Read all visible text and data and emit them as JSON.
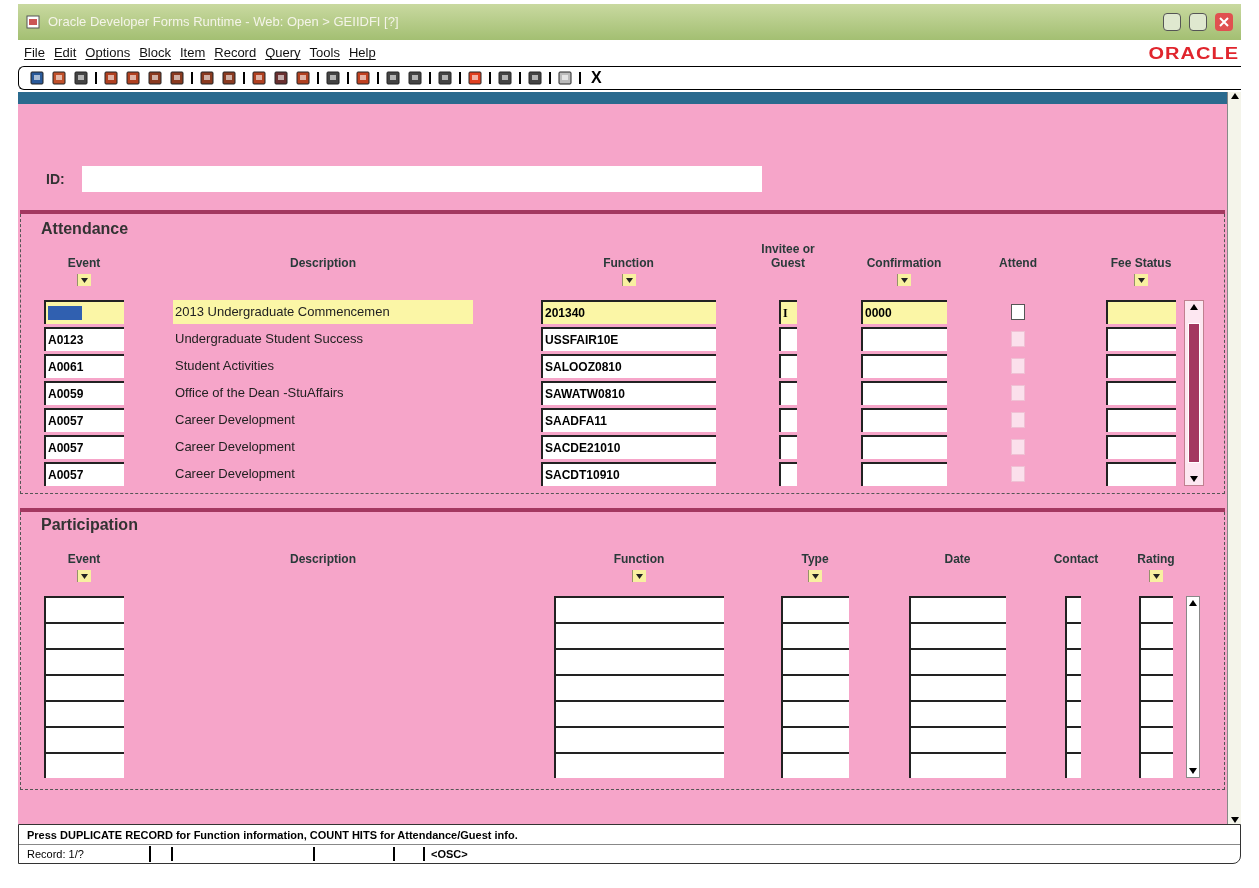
{
  "window": {
    "title": "Oracle Developer Forms Runtime - Web: Open > GEIIDFI [?]"
  },
  "menu": [
    "File",
    "Edit",
    "Options",
    "Block",
    "Item",
    "Record",
    "Query",
    "Tools",
    "Help"
  ],
  "brand": "ORACLE",
  "toolbar": {
    "exit_label": "X"
  },
  "id_field": {
    "label": "ID:"
  },
  "attendance": {
    "title": "Attendance",
    "columns": [
      {
        "label": "Event",
        "list_indicator": true
      },
      {
        "label": "Description",
        "list_indicator": false
      },
      {
        "label": "Function",
        "list_indicator": true
      },
      {
        "label": "Invitee or Guest",
        "list_indicator": false
      },
      {
        "label": "Confirmation",
        "list_indicator": true
      },
      {
        "label": "Attend",
        "list_indicator": false
      },
      {
        "label": "Fee Status",
        "list_indicator": true
      }
    ],
    "rows": [
      {
        "selected": true,
        "description": "2013 Undergraduate Commencemen",
        "function": "201340",
        "invitee": "I",
        "confirmation": "0000",
        "attend": false
      },
      {
        "selected": false,
        "event": "A0123",
        "description": "Undergraduate Student Success",
        "function": "USSFAIR10E",
        "attend": false
      },
      {
        "selected": false,
        "event": "A0061",
        "description": "Student Activities",
        "function": "SALOOZ0810",
        "attend": false
      },
      {
        "selected": false,
        "event": "A0059",
        "description": "Office of the Dean -StuAffairs",
        "function": "SAWATW0810",
        "attend": false
      },
      {
        "selected": false,
        "event": "A0057",
        "description": "Career Development",
        "function": "SAADFA11",
        "attend": false
      },
      {
        "selected": false,
        "event": "A0057",
        "description": "Career Development",
        "function": "SACDE21010",
        "attend": false
      },
      {
        "selected": false,
        "event": "A0057",
        "description": "Career Development",
        "function": "SACDT10910",
        "attend": false
      }
    ]
  },
  "participation": {
    "title": "Participation",
    "columns": [
      {
        "label": "Event",
        "list_indicator": true
      },
      {
        "label": "Description",
        "list_indicator": false
      },
      {
        "label": "Function",
        "list_indicator": true
      },
      {
        "label": "Type",
        "list_indicator": true
      },
      {
        "label": "Date",
        "list_indicator": false
      },
      {
        "label": "Contact",
        "list_indicator": false
      },
      {
        "label": "Rating",
        "list_indicator": true
      }
    ]
  },
  "hint": "Press DUPLICATE RECORD for Function information, COUNT HITS for Attendance/Guest info.",
  "status_bar": {
    "record": "Record: 1/?",
    "mode": "<OSC>"
  }
}
